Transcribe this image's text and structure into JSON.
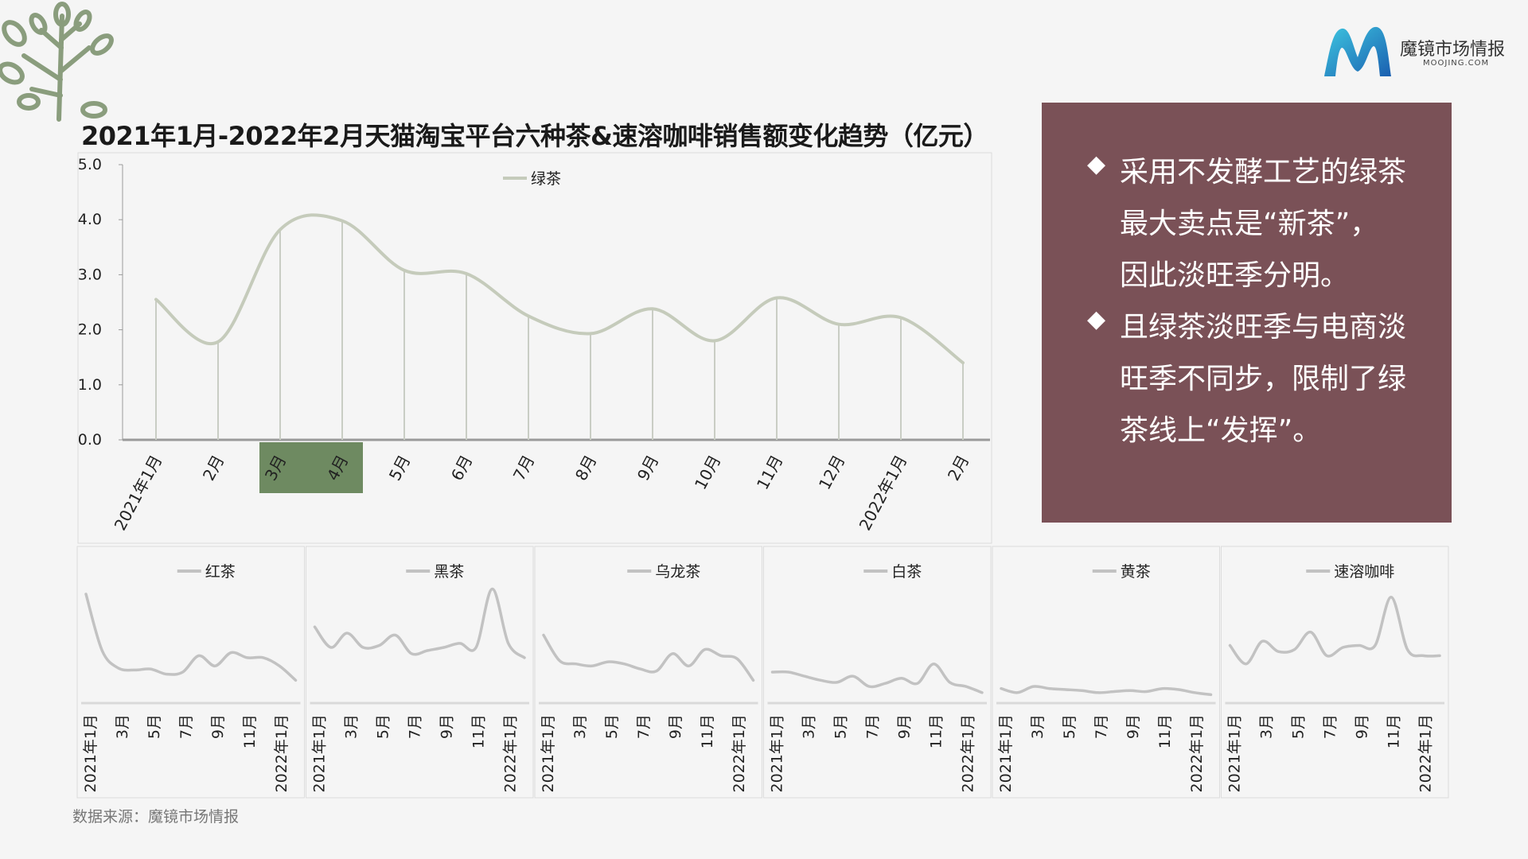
{
  "title": "2021年1月-2022年2月天猫淘宝平台六种茶&速溶咖啡销售额变化趋势（亿元）",
  "logo": {
    "name_cn": "魔镜市场情报",
    "name_en": "MOOJING.COM"
  },
  "note": {
    "lines": [
      {
        "bullet": true,
        "text": "采用不发酵工艺的绿茶"
      },
      {
        "bullet": false,
        "text": "最大卖点是“新茶”，"
      },
      {
        "bullet": false,
        "text": "因此淡旺季分明。"
      },
      {
        "bullet": true,
        "text": "且绿茶淡旺季与电商淡"
      },
      {
        "bullet": false,
        "text": "旺季不同步，限制了绿"
      },
      {
        "bullet": false,
        "text": "茶线上“发挥”。"
      }
    ]
  },
  "source": "数据来源：魔镜市场情报",
  "colors": {
    "line": "#c5cbbb",
    "small_line": "#c2c2c2",
    "highlight": "#6e8a61",
    "note_bg": "#7a5157",
    "leaf": "#8a9d7d"
  },
  "chart_data": [
    {
      "type": "line",
      "series": [
        {
          "name": "绿茶",
          "values": [
            2.55,
            1.78,
            3.82,
            3.98,
            3.08,
            3.02,
            2.25,
            1.93,
            2.38,
            1.8,
            2.58,
            2.1,
            2.22,
            1.4
          ]
        }
      ],
      "categories": [
        "2021年1月",
        "2月",
        "3月",
        "4月",
        "5月",
        "6月",
        "7月",
        "8月",
        "9月",
        "10月",
        "11月",
        "12月",
        "2022年1月",
        "2月"
      ],
      "ylim": [
        0,
        5
      ],
      "yticks": [
        "0.0",
        "1.0",
        "2.0",
        "3.0",
        "4.0",
        "5.0"
      ],
      "highlight_categories": [
        "3月",
        "4月"
      ],
      "legend": "top-center",
      "drop_lines": true
    },
    {
      "type": "line",
      "series": [
        {
          "name": "红茶",
          "values": [
            1.0,
            0.45,
            0.28,
            0.26,
            0.27,
            0.22,
            0.24,
            0.4,
            0.3,
            0.43,
            0.38,
            0.38,
            0.3,
            0.16
          ]
        }
      ],
      "categories": [
        "2021年1月",
        "3月",
        "5月",
        "7月",
        "9月",
        "11月",
        "2022年1月"
      ],
      "ylim": [
        0,
        1.1
      ],
      "legend": "top-center"
    },
    {
      "type": "line",
      "series": [
        {
          "name": "黑茶",
          "values": [
            0.68,
            0.48,
            0.62,
            0.48,
            0.5,
            0.6,
            0.42,
            0.45,
            0.48,
            0.52,
            0.48,
            1.05,
            0.52,
            0.38
          ]
        }
      ],
      "categories": [
        "2021年1月",
        "3月",
        "5月",
        "7月",
        "9月",
        "11月",
        "2022年1月"
      ],
      "ylim": [
        0,
        1.1
      ],
      "legend": "top-center"
    },
    {
      "type": "line",
      "series": [
        {
          "name": "乌龙茶",
          "values": [
            0.6,
            0.35,
            0.32,
            0.3,
            0.34,
            0.32,
            0.27,
            0.25,
            0.42,
            0.3,
            0.46,
            0.4,
            0.37,
            0.16
          ]
        }
      ],
      "categories": [
        "2021年1月",
        "3月",
        "5月",
        "7月",
        "9月",
        "11月",
        "2022年1月"
      ],
      "ylim": [
        0,
        1.1
      ],
      "legend": "top-center"
    },
    {
      "type": "line",
      "series": [
        {
          "name": "白茶",
          "values": [
            0.24,
            0.24,
            0.2,
            0.16,
            0.14,
            0.2,
            0.1,
            0.13,
            0.18,
            0.13,
            0.32,
            0.14,
            0.1,
            0.04
          ]
        }
      ],
      "categories": [
        "2021年1月",
        "3月",
        "5月",
        "7月",
        "9月",
        "11月",
        "2022年1月"
      ],
      "ylim": [
        0,
        1.1
      ],
      "legend": "top-center"
    },
    {
      "type": "line",
      "series": [
        {
          "name": "黄茶",
          "values": [
            0.08,
            0.04,
            0.1,
            0.08,
            0.07,
            0.06,
            0.04,
            0.05,
            0.06,
            0.05,
            0.08,
            0.07,
            0.04,
            0.02
          ]
        }
      ],
      "categories": [
        "2021年1月",
        "3月",
        "5月",
        "7月",
        "9月",
        "11月",
        "2022年1月"
      ],
      "ylim": [
        0,
        1.1
      ],
      "legend": "top-center"
    },
    {
      "type": "line",
      "series": [
        {
          "name": "速溶咖啡",
          "values": [
            0.5,
            0.32,
            0.54,
            0.44,
            0.46,
            0.63,
            0.4,
            0.48,
            0.5,
            0.5,
            0.97,
            0.46,
            0.4,
            0.4
          ]
        }
      ],
      "categories": [
        "2021年1月",
        "3月",
        "5月",
        "7月",
        "9月",
        "11月",
        "2022年1月"
      ],
      "ylim": [
        0,
        1.1
      ],
      "legend": "top-center"
    }
  ]
}
